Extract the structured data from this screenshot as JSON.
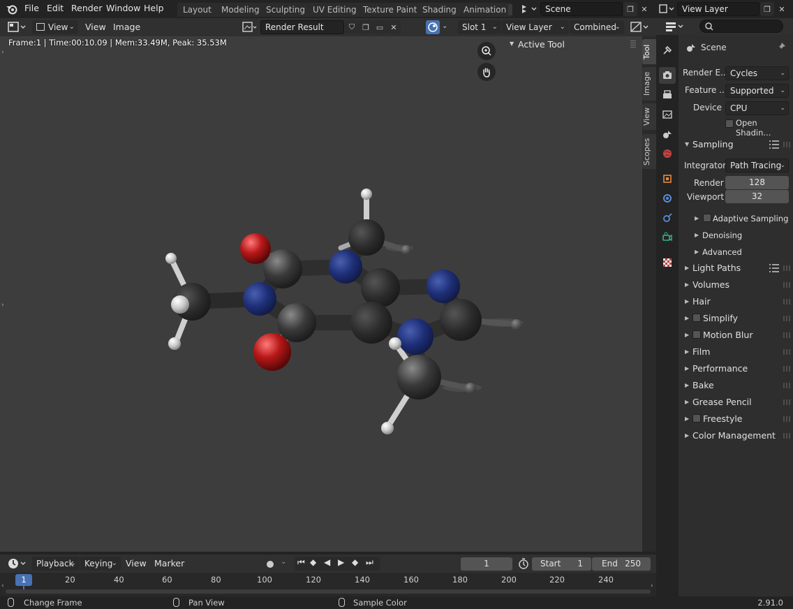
{
  "topbar": {
    "menus": [
      "File",
      "Edit",
      "Render",
      "Window",
      "Help"
    ],
    "workspaces": [
      "Layout",
      "Modeling",
      "Sculpting",
      "UV Editing",
      "Texture Paint",
      "Shading",
      "Animation"
    ],
    "scene_name": "Scene",
    "view_layer_name": "View Layer"
  },
  "image_editor": {
    "view_menu": "View",
    "menus": [
      "View",
      "Image"
    ],
    "image_name": "Render Result",
    "slot": "Slot 1",
    "view_layer": "View Layer",
    "pass": "Combined",
    "render_info": "Frame:1 | Time:00:10.09 | Mem:33.49M, Peak: 35.53M",
    "active_tool_title": "Active Tool",
    "side_tabs": [
      "Tool",
      "Image",
      "View",
      "Scopes"
    ]
  },
  "properties": {
    "scene_title": "Scene",
    "render_engine_label": "Render E...",
    "render_engine": "Cycles",
    "feature_set_label": "Feature ...",
    "feature_set": "Supported",
    "device_label": "Device",
    "device": "CPU",
    "open_shading_label": "Open Shadin...",
    "sampling": {
      "title": "Sampling",
      "integrator_label": "Integrator",
      "integrator": "Path Tracing",
      "render_label": "Render",
      "render_samples": "128",
      "viewport_label": "Viewport",
      "viewport_samples": "32",
      "subpanels": [
        "Adaptive Sampling",
        "Denoising",
        "Advanced"
      ]
    },
    "panels": [
      "Light Paths",
      "Volumes",
      "Hair",
      "Simplify",
      "Motion Blur",
      "Film",
      "Performance",
      "Bake",
      "Grease Pencil",
      "Freestyle",
      "Color Management"
    ]
  },
  "timeline": {
    "menus": [
      "Playback",
      "Keying",
      "View",
      "Marker"
    ],
    "current_frame": "1",
    "start_label": "Start",
    "start": "1",
    "end_label": "End",
    "end": "250",
    "ruler_current": "1",
    "ticks": [
      "20",
      "40",
      "60",
      "80",
      "100",
      "120",
      "140",
      "160",
      "180",
      "200",
      "220",
      "240"
    ]
  },
  "statusbar": {
    "hint1": "Change Frame",
    "hint2": "Pan View",
    "hint3": "Sample Color",
    "version": "2.91.0"
  },
  "colors": {
    "accent_blue": "#4772b3",
    "oxygen_red": "#b81818",
    "nitrogen_blue": "#1e2f78",
    "carbon_gray": "#2b2b2b",
    "hydrogen_white": "#d8d8d8"
  },
  "icons": [
    "blender-logo-icon",
    "zoom-icon",
    "hand-pan-icon",
    "pin-icon",
    "search-icon",
    "tool-icon",
    "render-icon",
    "output-icon",
    "view-layer-icon",
    "scene-icon",
    "world-icon",
    "object-icon",
    "modifier-icon",
    "physics-icon",
    "constraints-icon",
    "data-icon",
    "texture-icon"
  ]
}
